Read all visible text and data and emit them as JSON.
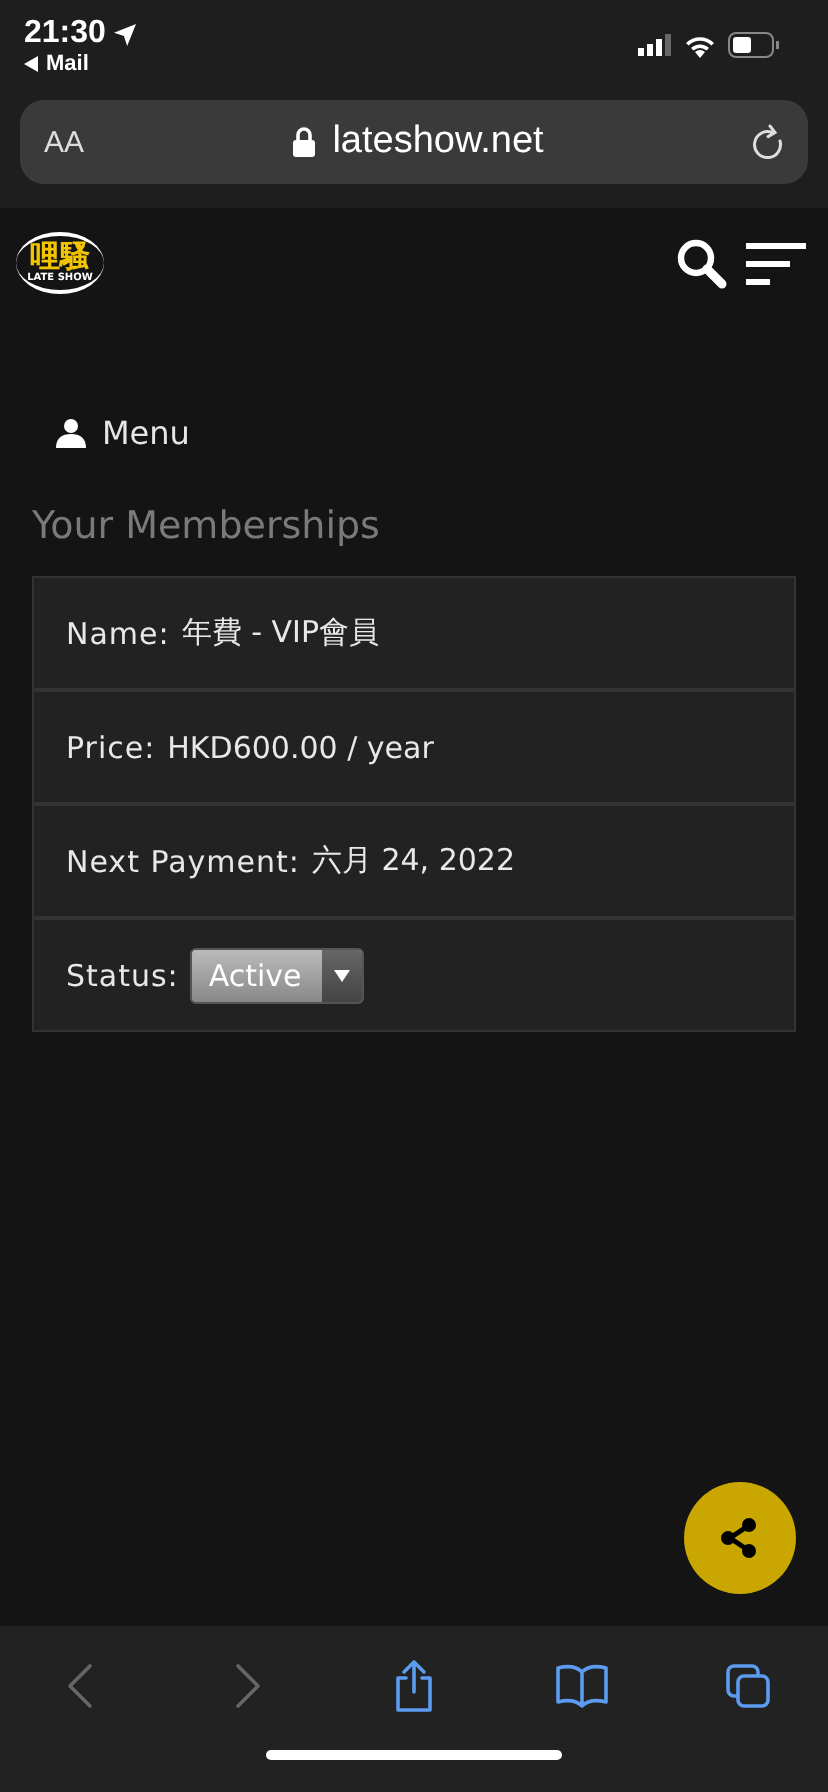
{
  "status_bar": {
    "time": "21:30",
    "back_app": "Mail"
  },
  "address_bar": {
    "text_size": "AA",
    "url": "lateshow.net"
  },
  "header": {
    "logo_title": "哩騷",
    "logo_subtitle": "LATE SHOW"
  },
  "menu": {
    "label": "Menu"
  },
  "heading": "Your Memberships",
  "membership": [
    {
      "kind": "text",
      "label": "Name:",
      "value": "年費 - VIP會員"
    },
    {
      "kind": "text",
      "label": "Price:",
      "value": "HKD600.00 / year"
    },
    {
      "kind": "text",
      "label": "Next Payment:",
      "value": "六月 24, 2022"
    },
    {
      "kind": "select",
      "label": "Status:",
      "value": "Active"
    }
  ],
  "toolbar": [
    {
      "kind": "back",
      "disabled": true
    },
    {
      "kind": "forward",
      "disabled": true
    },
    {
      "kind": "share",
      "disabled": false
    },
    {
      "kind": "bookmarks",
      "disabled": false
    },
    {
      "kind": "tabs",
      "disabled": false
    }
  ]
}
